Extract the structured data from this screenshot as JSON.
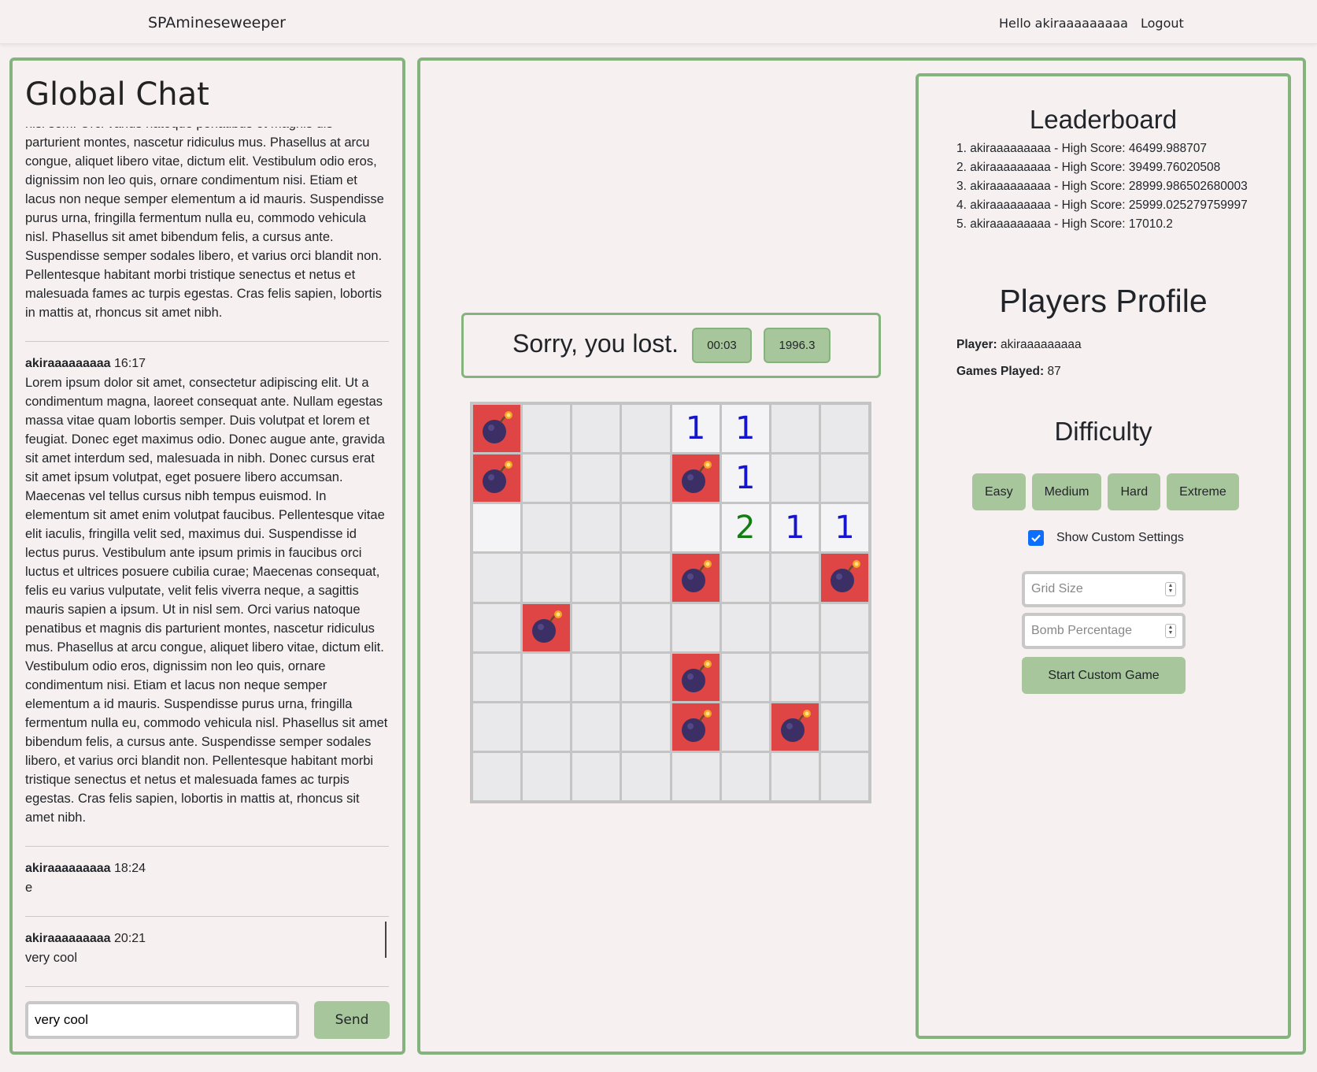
{
  "navbar": {
    "brand": "SPAmineseweeper",
    "greeting": "Hello akiraaaaaaaaa",
    "logout": "Logout"
  },
  "chat": {
    "title": "Global Chat",
    "messages": [
      {
        "author": "",
        "time": "",
        "text": "ante ipsum primis in faucibus orci luctus et ultrices posuere cubilia curae; Maecenas consequat, felis eu varius vulputate, velit felis viverra neque, a sagittis mauris sapien a ipsum. Ut in nisl sem. Orci varius natoque penatibus et magnis dis parturient montes, nascetur ridiculus mus. Phasellus at arcu congue, aliquet libero vitae, dictum elit. Vestibulum odio eros, dignissim non leo quis, ornare condimentum nisi. Etiam et lacus non neque semper elementum a id mauris. Suspendisse purus urna, fringilla fermentum nulla eu, commodo vehicula nisl. Phasellus sit amet bibendum felis, a cursus ante. Suspendisse semper sodales libero, et varius orci blandit non. Pellentesque habitant morbi tristique senectus et netus et malesuada fames ac turpis egestas. Cras felis sapien, lobortis in mattis at, rhoncus sit amet nibh."
      },
      {
        "author": "akiraaaaaaaaa",
        "time": "16:17",
        "text": "Lorem ipsum dolor sit amet, consectetur adipiscing elit. Ut a condimentum magna, laoreet consequat ante. Nullam egestas massa vitae quam lobortis semper. Duis volutpat et lorem et feugiat. Donec eget maximus odio. Donec augue ante, gravida sit amet interdum sed, malesuada in nibh. Donec cursus erat sit amet ipsum volutpat, eget posuere libero accumsan. Maecenas vel tellus cursus nibh tempus euismod. In elementum sit amet enim volutpat faucibus. Pellentesque vitae elit iaculis, fringilla velit sed, maximus dui. Suspendisse id lectus purus. Vestibulum ante ipsum primis in faucibus orci luctus et ultrices posuere cubilia curae; Maecenas consequat, felis eu varius vulputate, velit felis viverra neque, a sagittis mauris sapien a ipsum. Ut in nisl sem. Orci varius natoque penatibus et magnis dis parturient montes, nascetur ridiculus mus. Phasellus at arcu congue, aliquet libero vitae, dictum elit. Vestibulum odio eros, dignissim non leo quis, ornare condimentum nisi. Etiam et lacus non neque semper elementum a id mauris. Suspendisse purus urna, fringilla fermentum nulla eu, commodo vehicula nisl. Phasellus sit amet bibendum felis, a cursus ante. Suspendisse semper sodales libero, et varius orci blandit non. Pellentesque habitant morbi tristique senectus et netus et malesuada fames ac turpis egestas. Cras felis sapien, lobortis in mattis at, rhoncus sit amet nibh."
      },
      {
        "author": "akiraaaaaaaaa",
        "time": "18:24",
        "text": "e"
      },
      {
        "author": "akiraaaaaaaaa",
        "time": "20:21",
        "text": "very cool"
      }
    ],
    "input_value": "very cool",
    "send_label": "Send"
  },
  "game": {
    "status": "Sorry, you lost.",
    "timer": "00:03",
    "score": "1996.3",
    "board": [
      [
        "B",
        "",
        "",
        "",
        "1",
        "1",
        "",
        ""
      ],
      [
        "B",
        "",
        "",
        "",
        "B",
        "1",
        "",
        ""
      ],
      [
        ".",
        "",
        "",
        "",
        ".",
        "2",
        "1",
        "1"
      ],
      [
        "",
        "",
        "",
        "",
        "B",
        "",
        "",
        "B"
      ],
      [
        "",
        "B",
        "",
        "",
        "",
        "",
        "",
        ""
      ],
      [
        "",
        "",
        "",
        "",
        "B",
        "",
        "",
        ""
      ],
      [
        "",
        "",
        "",
        "",
        "B",
        "",
        "B",
        ""
      ],
      [
        "",
        "",
        "",
        "",
        "",
        "",
        "",
        ""
      ]
    ],
    "number_colors": {
      "1": "#1515d0",
      "2": "#137d13"
    }
  },
  "leaderboard": {
    "title": "Leaderboard",
    "entries": [
      "1. akiraaaaaaaaa - High Score: 46499.988707",
      "2. akiraaaaaaaaa - High Score: 39499.76020508",
      "3. akiraaaaaaaaa - High Score: 28999.986502680003",
      "4. akiraaaaaaaaa - High Score: 25999.025279759997",
      "5. akiraaaaaaaaa - High Score: 17010.2"
    ]
  },
  "profile": {
    "title": "Players Profile",
    "player_label": "Player:",
    "player_value": "akiraaaaaaaaa",
    "games_label": "Games Played:",
    "games_value": "87"
  },
  "difficulty": {
    "title": "Difficulty",
    "buttons": [
      "Easy",
      "Medium",
      "Hard",
      "Extreme"
    ],
    "show_custom_label": "Show Custom Settings",
    "show_custom_checked": true,
    "grid_size_placeholder": "Grid Size",
    "bomb_pct_placeholder": "Bomb Percentage",
    "start_custom_label": "Start Custom Game"
  },
  "colors": {
    "accent_border": "#85b37e",
    "button_green": "#a8c69b",
    "bomb_cell": "#e04545"
  }
}
